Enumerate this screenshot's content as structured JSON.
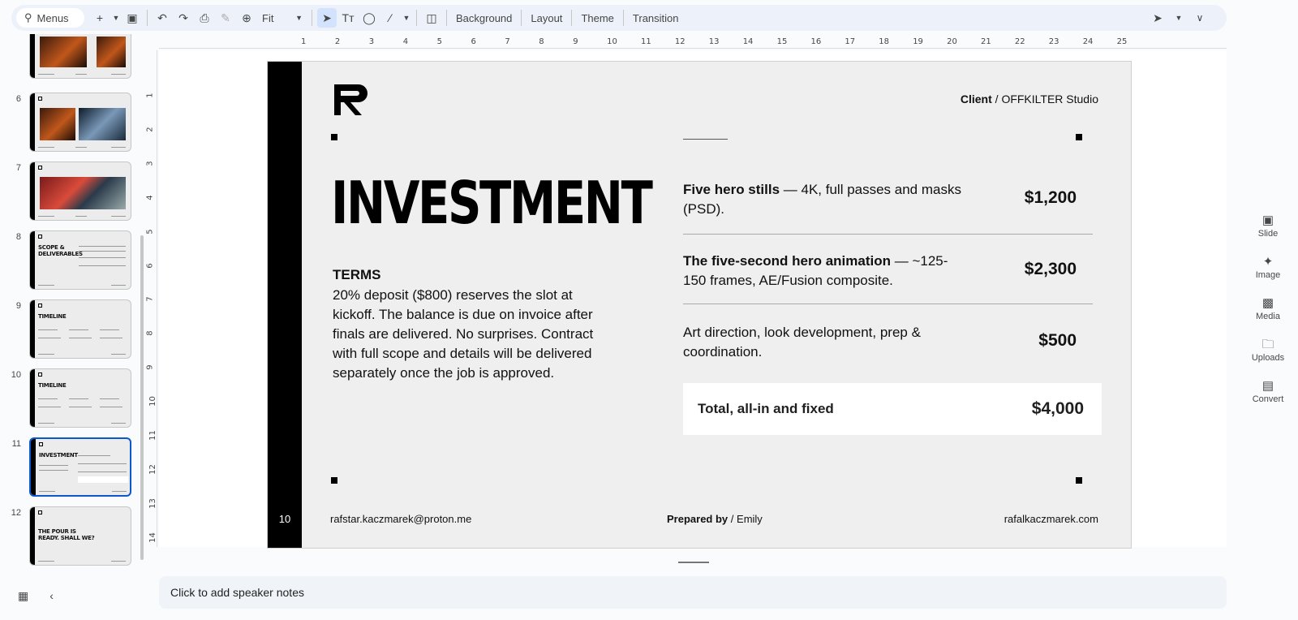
{
  "toolbar": {
    "menus_label": "Menus",
    "zoom_value": "Fit",
    "background_label": "Background",
    "layout_label": "Layout",
    "theme_label": "Theme",
    "transition_label": "Transition"
  },
  "filmstrip": {
    "slides": [
      {
        "num": "",
        "title": ""
      },
      {
        "num": "6",
        "title": ""
      },
      {
        "num": "7",
        "title": ""
      },
      {
        "num": "8",
        "title": "SCOPE & DELIVERABLES"
      },
      {
        "num": "9",
        "title": "TIMELINE"
      },
      {
        "num": "10",
        "title": "TIMELINE"
      },
      {
        "num": "11",
        "title": "INVESTMENT"
      },
      {
        "num": "12",
        "title": "THE POUR IS READY. SHALL WE?"
      }
    ]
  },
  "slide": {
    "page_number": "10",
    "client_label": "Client",
    "client_sep": "/",
    "client_name": "OFFKILTER Studio",
    "heading": "INVESTMENT",
    "terms_title": "TERMS",
    "terms_body": "20% deposit ($800) reserves the slot at kickoff. The balance is due on invoice after finals are delivered. No surprises. Contract with full scope and details will be delivered separately once the job is approved.",
    "items": [
      {
        "bold": "Five hero stills",
        "rest": " — 4K, full passes and masks (PSD).",
        "price": "$1,200"
      },
      {
        "bold": "The five-second hero animation",
        "rest": " — ~125-150 frames, AE/Fusion composite.",
        "price": "$2,300"
      },
      {
        "bold": "",
        "rest": "Art direction, look development, prep & coordination.",
        "price": "$500"
      }
    ],
    "total_label": "Total, all-in and fixed",
    "total_amount": "$4,000",
    "footer_email": "rafstar.kaczmarek@proton.me",
    "prepared_label": "Prepared by",
    "prepared_sep": "/",
    "prepared_name": "Emily",
    "footer_site": "rafalkaczmarek.com"
  },
  "right_panel": {
    "slide_label": "Slide",
    "image_label": "Image",
    "media_label": "Media",
    "uploads_label": "Uploads",
    "convert_label": "Convert"
  },
  "notes": {
    "placeholder": "Click to add speaker notes"
  },
  "ruler": {
    "h_ticks": [
      "1",
      "2",
      "3",
      "4",
      "5",
      "6",
      "7",
      "8",
      "9",
      "10",
      "11",
      "12",
      "13",
      "14",
      "15",
      "16",
      "17",
      "18",
      "19",
      "20",
      "21",
      "22",
      "23",
      "24",
      "25"
    ],
    "v_ticks": [
      "1",
      "2",
      "3",
      "4",
      "5",
      "6",
      "7",
      "8",
      "9",
      "10",
      "11",
      "12",
      "13",
      "14"
    ]
  }
}
